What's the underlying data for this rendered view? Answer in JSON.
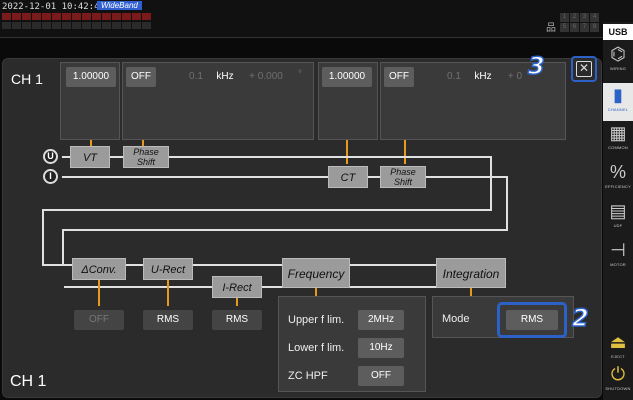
{
  "status": {
    "datetime": "2022-12-01 10:42:44",
    "mode_badge": "WideBand",
    "usb": "USB",
    "slots": [
      "1",
      "2",
      "3",
      "4",
      "5",
      "6",
      "7",
      "8"
    ]
  },
  "channel": {
    "title": "CH 1",
    "footer": "CH 1"
  },
  "voltage_settings": {
    "scale": "1.00000",
    "filter": "OFF",
    "freq": "0.1",
    "freq_unit": "kHz",
    "phase": "+ 0.000",
    "phase_unit": "°"
  },
  "current_settings": {
    "scale": "1.00000",
    "filter": "OFF",
    "freq": "0.1",
    "freq_unit": "kHz",
    "phase": "+ 0"
  },
  "blocks": {
    "vt": "VT",
    "phase_shift_v": "Phase\nShift",
    "ct": "CT",
    "phase_shift_i": "Phase\nShift",
    "delta_conv": "ΔConv.",
    "u_rect": "U-Rect",
    "i_rect": "I-Rect",
    "frequency": "Frequency",
    "integration": "Integration"
  },
  "nodes": {
    "u": "U",
    "i": "I"
  },
  "bottom_values": {
    "delta_conv": "OFF",
    "u_rect": "RMS",
    "i_rect": "RMS",
    "integration_mode": "RMS"
  },
  "frequency_settings": {
    "upper_label": "Upper f lim.",
    "upper_value": "2MHz",
    "lower_label": "Lower f lim.",
    "lower_value": "10Hz",
    "zc_label": "ZC HPF",
    "zc_value": "OFF"
  },
  "integration_settings": {
    "mode_label": "Mode"
  },
  "callouts": {
    "close": "3",
    "mode": "2"
  },
  "right_menu": [
    {
      "icon": "wiring-icon",
      "glyph": "⌬",
      "label": "WIRING"
    },
    {
      "icon": "channel-icon",
      "glyph": "▮",
      "label": "CHANNEL"
    },
    {
      "icon": "common-icon",
      "glyph": "▦",
      "label": "COMMON"
    },
    {
      "icon": "efficiency-icon",
      "glyph": "%",
      "label": "EFFICIENCY"
    },
    {
      "icon": "udf-icon",
      "glyph": "▤",
      "label": "UDF"
    },
    {
      "icon": "motor-icon",
      "glyph": "⊣",
      "label": "MOTOR"
    },
    {
      "icon": "eject-icon",
      "glyph": "⏏",
      "label": "EJECT"
    },
    {
      "icon": "shutdown-icon",
      "glyph": "⏻",
      "label": "SHUTDOWN"
    }
  ],
  "colors": {
    "accent": "#2c62c8",
    "signal_line": "#e89a1e",
    "panel": "#2b2b2b"
  }
}
